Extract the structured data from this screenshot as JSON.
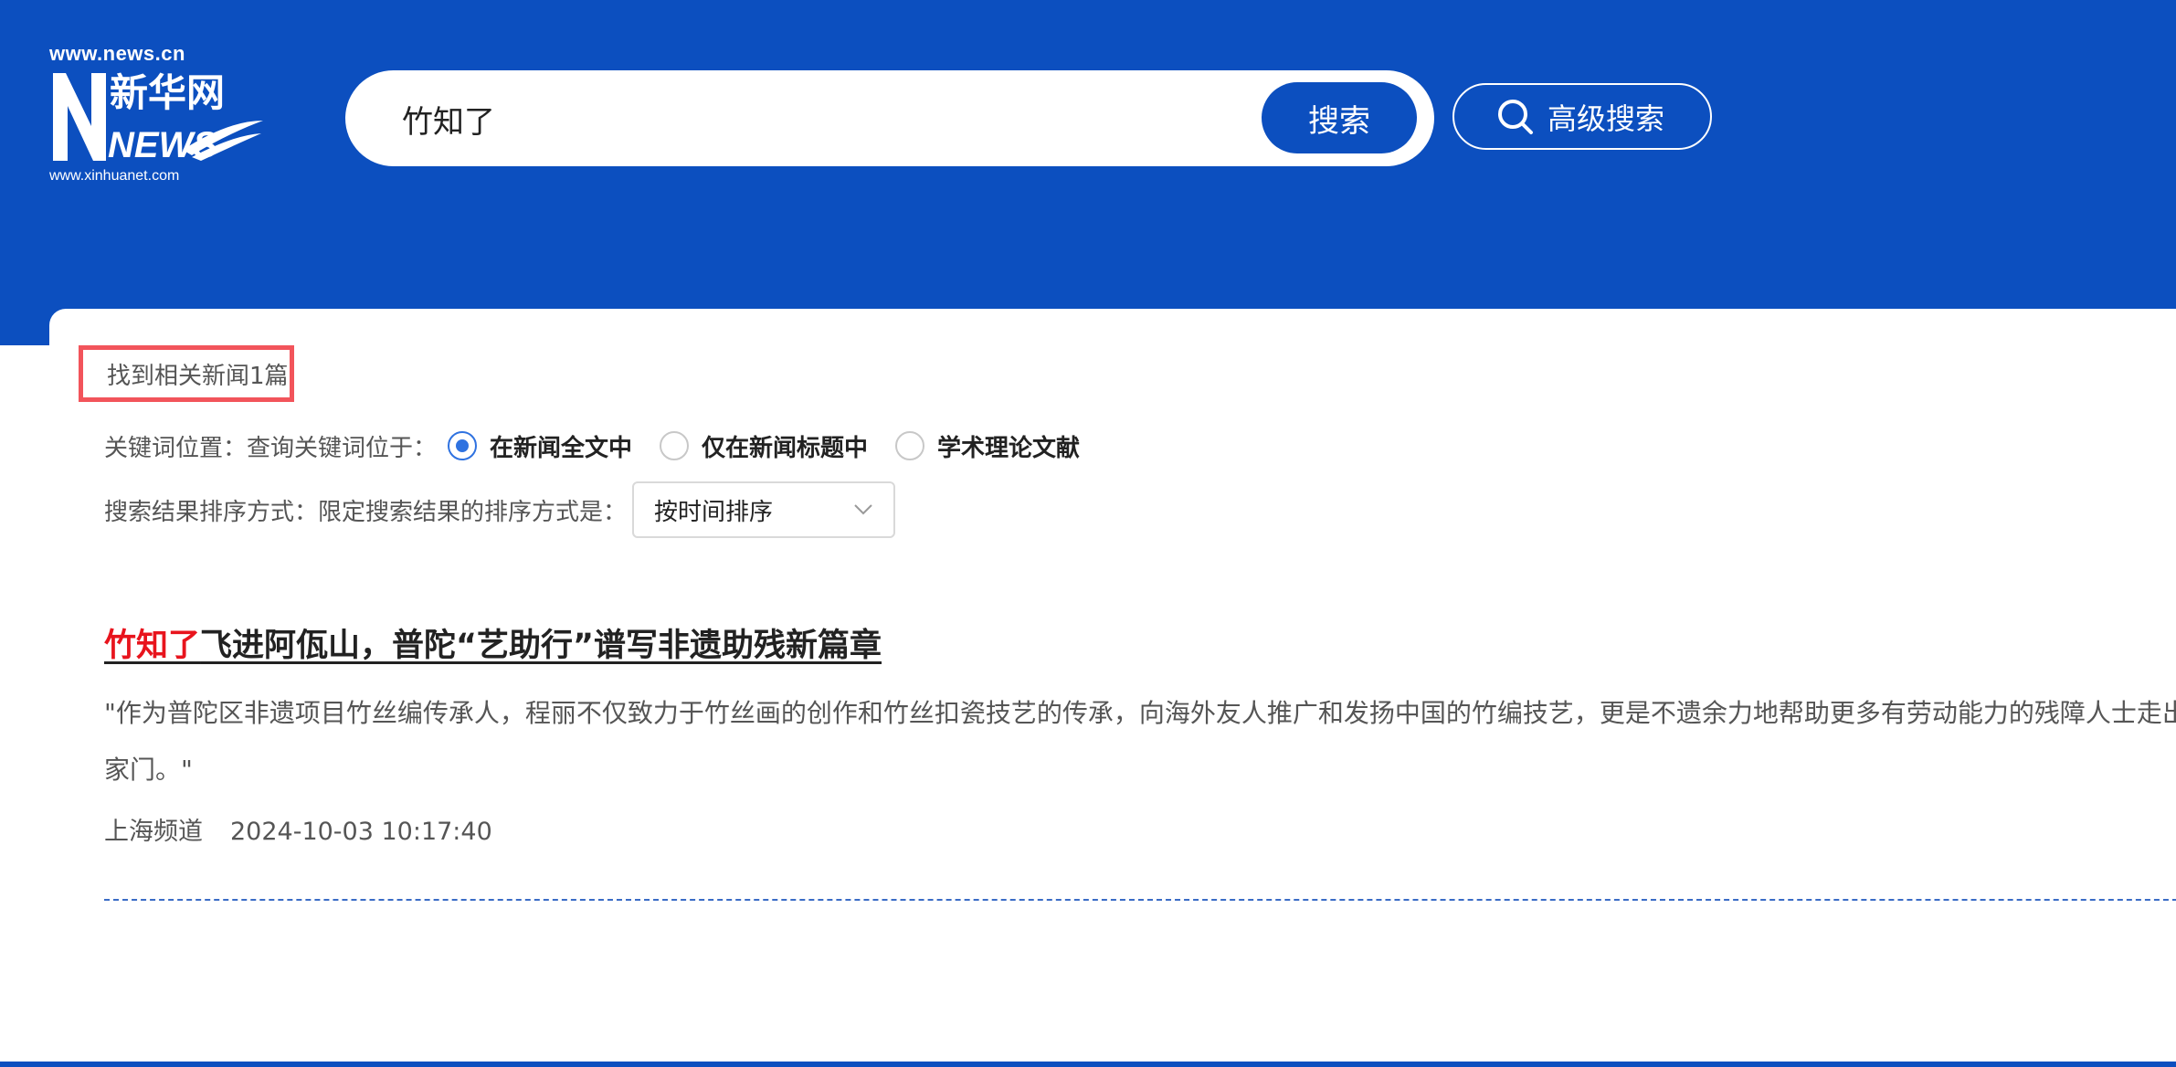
{
  "header": {
    "logo": {
      "top_text": "www.news.cn",
      "brand_chinese": "新华网",
      "brand_letters": "NEWS",
      "bottom_text": "www.xinhuanet.com"
    },
    "search": {
      "query": "竹知了",
      "button_label": "搜索"
    },
    "advanced_search_label": "高级搜索"
  },
  "results": {
    "count_text": "找到相关新闻1篇",
    "keyword_position": {
      "label": "关键词位置：查询关键词位于：",
      "options": [
        "在新闻全文中",
        "仅在新闻标题中",
        "学术理论文献"
      ],
      "selected": "在新闻全文中"
    },
    "sort": {
      "label": "搜索结果排序方式：限定搜索结果的排序方式是：",
      "selected": "按时间排序"
    },
    "items": [
      {
        "title_highlight": "竹知了",
        "title_rest": "飞进阿佤山，普陀“艺助行”谱写非遗助残新篇章",
        "snippet": "\"作为普陀区非遗项目竹丝编传承人，程丽不仅致力于竹丝画的创作和竹丝扣瓷技艺的传承，向海外友人推广和发扬中国的竹编技艺，更是不遗余力地帮助更多有劳动能力的残障人士走出家门。\"",
        "source": "上海频道",
        "datetime": "2024-10-03 10:17:40"
      }
    ]
  },
  "colors": {
    "brand_blue": "#0c4fbf",
    "highlight_red": "#e8141d",
    "annotation_red": "#f2545b",
    "radio_blue": "#2f72e0"
  },
  "icons": [
    "search-icon",
    "chevron-down-icon"
  ]
}
